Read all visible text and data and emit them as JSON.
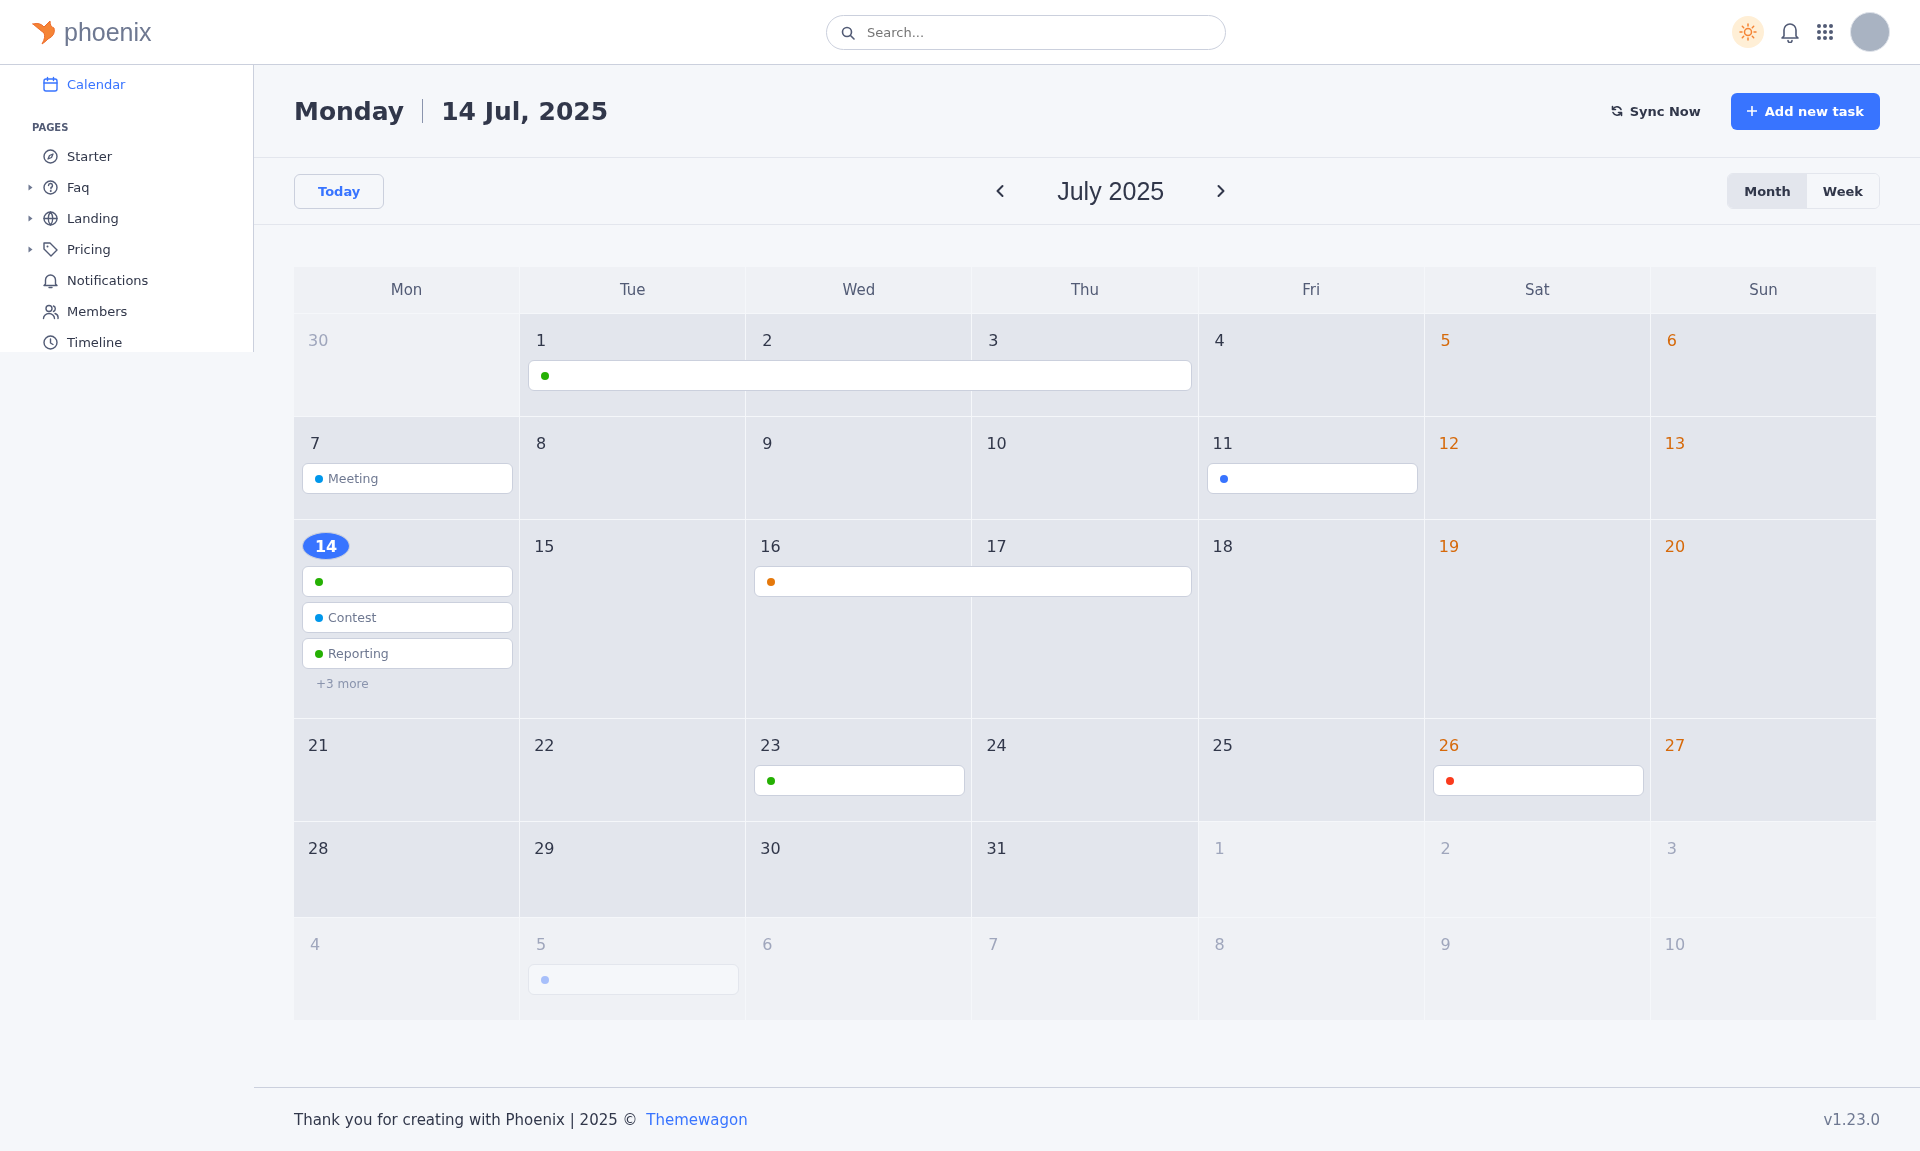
{
  "topbar": {
    "logo": "phoenix",
    "search": {
      "placeholder": "Search..."
    }
  },
  "sidebar": {
    "items": [
      {
        "label": "Calendar",
        "selected": true
      }
    ],
    "section": "PAGES",
    "pages": [
      {
        "label": "Starter",
        "selected": false
      },
      {
        "label": "Faq",
        "selected": false,
        "expanded": false
      },
      {
        "label": "Landing",
        "selected": false,
        "expanded": false
      },
      {
        "label": "Pricing",
        "selected": false,
        "expanded": false
      },
      {
        "label": "Notifications",
        "selected": false
      },
      {
        "label": "Members",
        "selected": false
      },
      {
        "label": "Timeline",
        "selected": false
      }
    ]
  },
  "header": {
    "weekday": "Monday",
    "date": "14 Jul, 2025",
    "sync": "Sync Now",
    "add": "Add new task"
  },
  "toolbar": {
    "today": "Today",
    "month": "July 2025",
    "views": [
      {
        "label": "Month",
        "selected": true
      },
      {
        "label": "Week",
        "selected": false
      }
    ]
  },
  "calendar": {
    "weekdays": [
      "Mon",
      "Tue",
      "Wed",
      "Thu",
      "Fri",
      "Sat",
      "Sun"
    ],
    "weeks": [
      {
        "days": [
          {
            "date": "30",
            "in_month": false,
            "today": false
          },
          {
            "date": "1",
            "in_month": true,
            "today": false,
            "events": [
              {
                "kind": "start",
                "color": "#25b003",
                "faded": false
              }
            ]
          },
          {
            "date": "2",
            "in_month": true,
            "today": false,
            "events": [
              {
                "kind": "middle"
              }
            ]
          },
          {
            "date": "3",
            "in_month": true,
            "today": false,
            "events": [
              {
                "kind": "end"
              }
            ]
          },
          {
            "date": "4",
            "in_month": true,
            "today": false
          },
          {
            "date": "5",
            "in_month": true,
            "today": false
          },
          {
            "date": "6",
            "in_month": true,
            "today": false
          }
        ]
      },
      {
        "days": [
          {
            "date": "7",
            "in_month": true,
            "today": false,
            "events": [
              {
                "kind": "single",
                "color": "#0097eb",
                "title": "Meeting",
                "faded": false
              }
            ]
          },
          {
            "date": "8",
            "in_month": true,
            "today": false
          },
          {
            "date": "9",
            "in_month": true,
            "today": false
          },
          {
            "date": "10",
            "in_month": true,
            "today": false
          },
          {
            "date": "11",
            "in_month": true,
            "today": false,
            "events": [
              {
                "kind": "single",
                "color": "#3874ff",
                "faded": false
              }
            ]
          },
          {
            "date": "12",
            "in_month": true,
            "today": false
          },
          {
            "date": "13",
            "in_month": true,
            "today": false
          }
        ]
      },
      {
        "days": [
          {
            "date": "14",
            "in_month": true,
            "today": true,
            "events": [
              {
                "kind": "single",
                "color": "#25b003",
                "faded": false
              },
              {
                "kind": "single",
                "color": "#0097eb",
                "title": "Contest",
                "faded": false
              },
              {
                "kind": "single",
                "color": "#25b003",
                "title": "Reporting",
                "faded": false
              }
            ],
            "more": "+3 more"
          },
          {
            "date": "15",
            "in_month": true,
            "today": false
          },
          {
            "date": "16",
            "in_month": true,
            "today": false,
            "events": [
              {
                "kind": "start",
                "color": "#e5780b",
                "faded": false
              }
            ]
          },
          {
            "date": "17",
            "in_month": true,
            "today": false,
            "events": [
              {
                "kind": "end"
              }
            ]
          },
          {
            "date": "18",
            "in_month": true,
            "today": false
          },
          {
            "date": "19",
            "in_month": true,
            "today": false
          },
          {
            "date": "20",
            "in_month": true,
            "today": false
          }
        ]
      },
      {
        "days": [
          {
            "date": "21",
            "in_month": true,
            "today": false
          },
          {
            "date": "22",
            "in_month": true,
            "today": false
          },
          {
            "date": "23",
            "in_month": true,
            "today": false,
            "events": [
              {
                "kind": "single",
                "color": "#25b003",
                "faded": false
              }
            ]
          },
          {
            "date": "24",
            "in_month": true,
            "today": false
          },
          {
            "date": "25",
            "in_month": true,
            "today": false
          },
          {
            "date": "26",
            "in_month": true,
            "today": false,
            "events": [
              {
                "kind": "single",
                "color": "#fa3b1d",
                "faded": false
              }
            ]
          },
          {
            "date": "27",
            "in_month": true,
            "today": false
          }
        ]
      },
      {
        "days": [
          {
            "date": "28",
            "in_month": true,
            "today": false
          },
          {
            "date": "29",
            "in_month": true,
            "today": false
          },
          {
            "date": "30",
            "in_month": true,
            "today": false
          },
          {
            "date": "31",
            "in_month": true,
            "today": false
          },
          {
            "date": "1",
            "in_month": false,
            "today": false
          },
          {
            "date": "2",
            "in_month": false,
            "today": false
          },
          {
            "date": "3",
            "in_month": false,
            "today": false
          }
        ]
      },
      {
        "days": [
          {
            "date": "4",
            "in_month": false,
            "today": false
          },
          {
            "date": "5",
            "in_month": false,
            "today": false,
            "events": [
              {
                "kind": "single",
                "color": "#a7bffa",
                "faded": true
              }
            ]
          },
          {
            "date": "6",
            "in_month": false,
            "today": false
          },
          {
            "date": "7",
            "in_month": false,
            "today": false
          },
          {
            "date": "8",
            "in_month": false,
            "today": false
          },
          {
            "date": "9",
            "in_month": false,
            "today": false
          },
          {
            "date": "10",
            "in_month": false,
            "today": false
          }
        ]
      }
    ]
  },
  "footer": {
    "text": "Thank you for creating with Phoenix | 2025 © ",
    "link": "Themewagon",
    "version": "v1.23.0"
  }
}
